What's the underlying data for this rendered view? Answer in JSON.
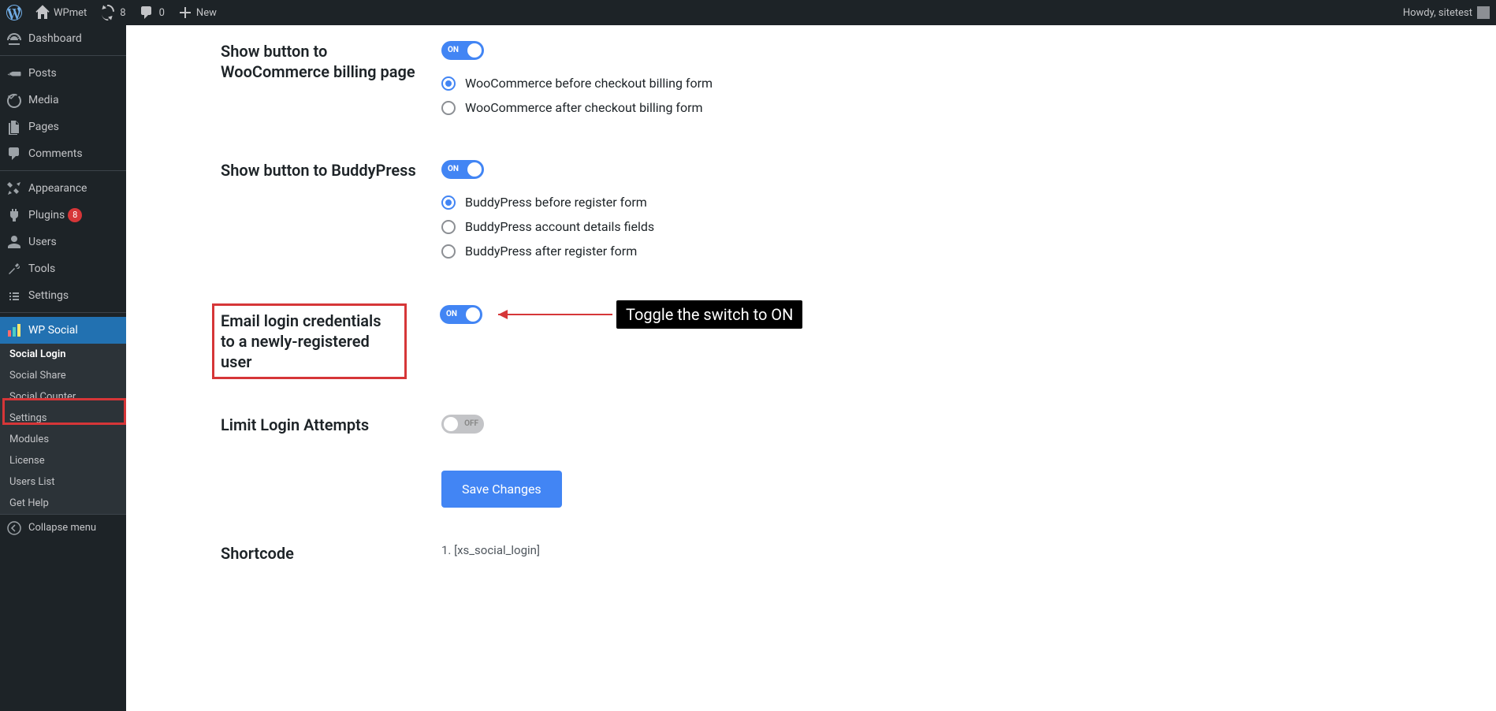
{
  "adminbar": {
    "site_name": "WPmet",
    "updates": "8",
    "comments": "0",
    "new": "New",
    "howdy": "Howdy, sitetest"
  },
  "sidebar": {
    "dashboard": "Dashboard",
    "posts": "Posts",
    "media": "Media",
    "pages": "Pages",
    "comments": "Comments",
    "appearance": "Appearance",
    "plugins": "Plugins",
    "plugins_badge": "8",
    "users": "Users",
    "tools": "Tools",
    "settings": "Settings",
    "wp_social": "WP Social",
    "collapse": "Collapse menu",
    "submenu": {
      "social_login": "Social Login",
      "social_share": "Social Share",
      "social_counter": "Social Counter",
      "settings": "Settings",
      "modules": "Modules",
      "license": "License",
      "users_list": "Users List",
      "get_help": "Get Help"
    }
  },
  "settings": {
    "woo": {
      "title": "Show button to WooCommerce billing page",
      "toggle_label": "ON",
      "r1": "WooCommerce before checkout billing form",
      "r2": "WooCommerce after checkout billing form"
    },
    "bp": {
      "title": "Show button to BuddyPress",
      "toggle_label": "ON",
      "r1": "BuddyPress before register form",
      "r2": "BuddyPress account details fields",
      "r3": "BuddyPress after register form"
    },
    "email": {
      "title": "Email login credentials to a newly-registered user",
      "toggle_label": "ON",
      "tooltip": "Toggle the switch to ON"
    },
    "limit": {
      "title": "Limit Login Attempts",
      "toggle_label": "OFF"
    },
    "save": "Save Changes",
    "shortcode": {
      "title": "Shortcode",
      "value": "1. [xs_social_login]"
    }
  }
}
